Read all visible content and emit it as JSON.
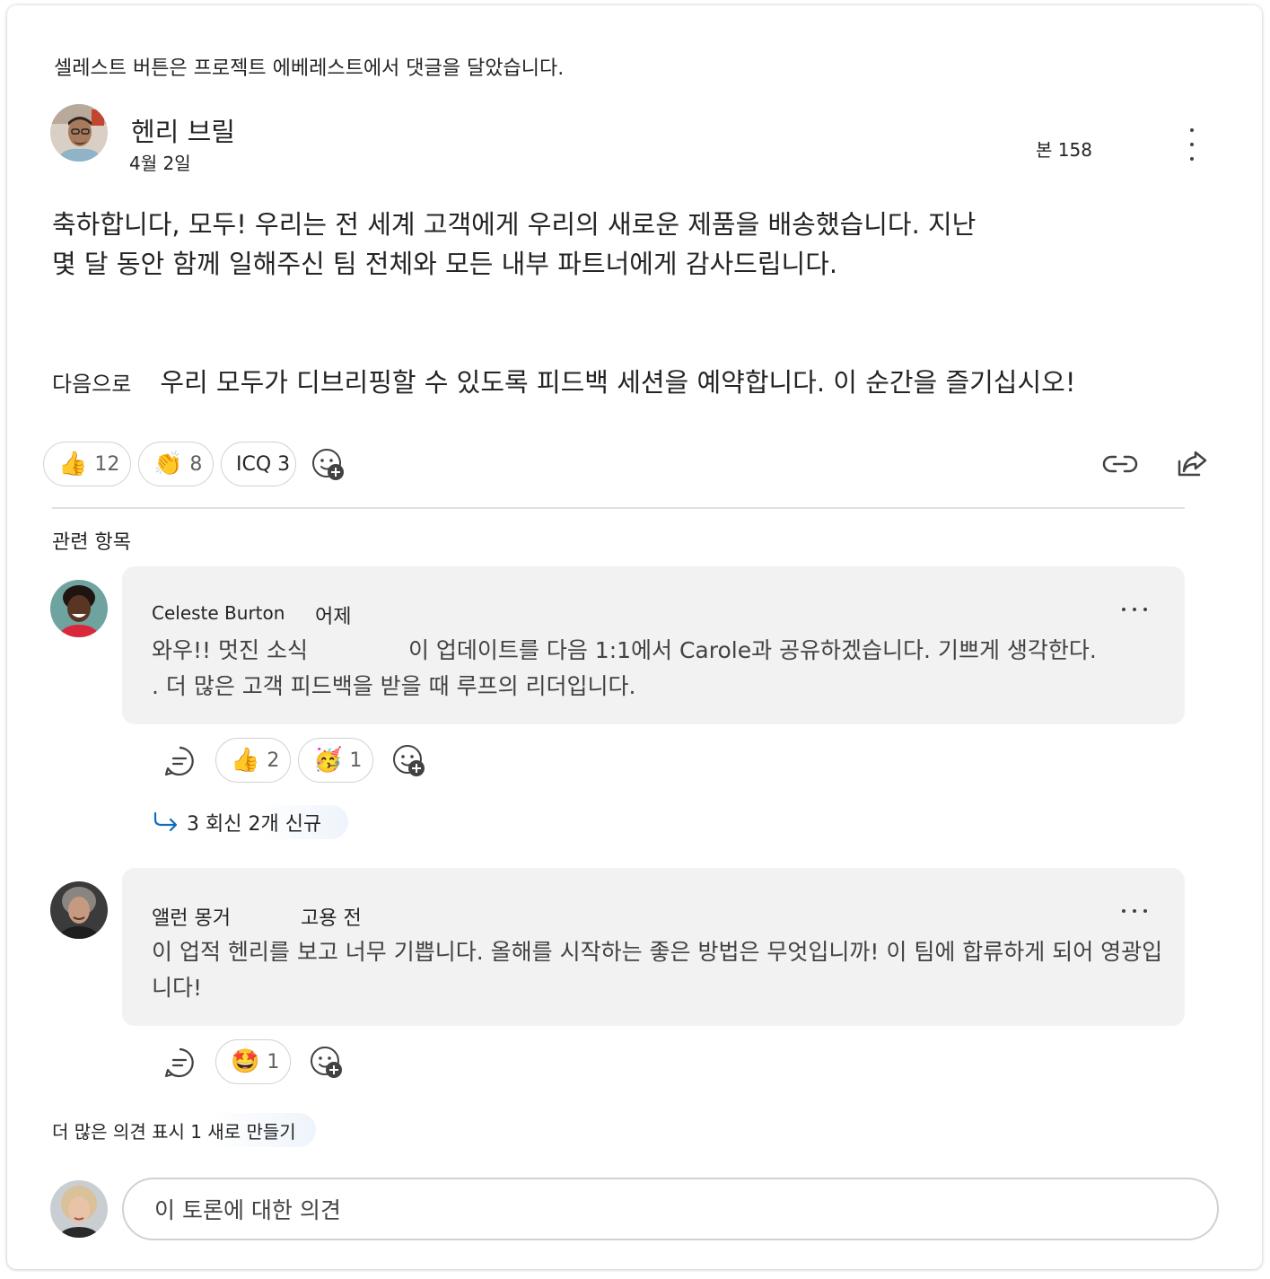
{
  "post": {
    "activity_line": "셀레스트 버튼은 프로젝트 에베레스트에서 댓글을 달았습니다.",
    "author": "헨리 브릴",
    "date": "4월 2일",
    "views": "본 158",
    "body_paragraph_1": "축하합니다, 모두! 우리는 전 세계 고객에게 우리의 새로운 제품을 배송했습니다. 지난 몇 달 동안 함께 일해주신 팀 전체와 모든 내부 파트너에게 감사드립니다.",
    "body_paragraph_2_lead": "다음으로",
    "body_paragraph_2_rest": "우리 모두가 디브리핑할 수 있도록 피드백 세션을 예약합니다. 이 순간을 즐기십시오!",
    "reactions": [
      {
        "icon": "thumbs-up",
        "emoji": "👍",
        "count": "12"
      },
      {
        "icon": "clapping-hands",
        "emoji": "👏",
        "count": "8"
      },
      {
        "icon": "icq",
        "label": "ICQ 3"
      }
    ]
  },
  "related_heading": "관련 항목",
  "comments": [
    {
      "author": "Celeste Burton",
      "time": "어제",
      "text_part1": "와우!! 멋진 소식",
      "text_part2": "이 업데이트를 다음 1:1에서 Carole과 공유하겠습니다. 기쁘게 생각한다.",
      "text_line2": ". 더 많은 고객 피드백을 받을 때 루프의 리더입니다.",
      "reactions": [
        {
          "icon": "thumbs-up",
          "emoji": "👍",
          "count": "2"
        },
        {
          "icon": "party-face",
          "emoji": "🥳",
          "count": "1"
        }
      ],
      "replies_label": "3 회신 2개 신규"
    },
    {
      "author": "앨런 몽거",
      "time": "고용 전",
      "text": "이 업적 헨리를 보고 너무 기쁩니다. 올해를 시작하는 좋은 방법은 무엇입니까! 이 팀에 합류하게 되어 영광입니다!",
      "reactions": [
        {
          "icon": "star-struck",
          "emoji": "🤩",
          "count": "1"
        }
      ]
    }
  ],
  "more_comments_label": "더 많은 의견 표시 1 새로 만들기",
  "composer": {
    "placeholder": "이 토론에 대한 의견"
  },
  "colors": {
    "accent_blue": "#0f6cbd",
    "bubble_bg": "#f2f2f2",
    "border": "#d1d1d1"
  }
}
